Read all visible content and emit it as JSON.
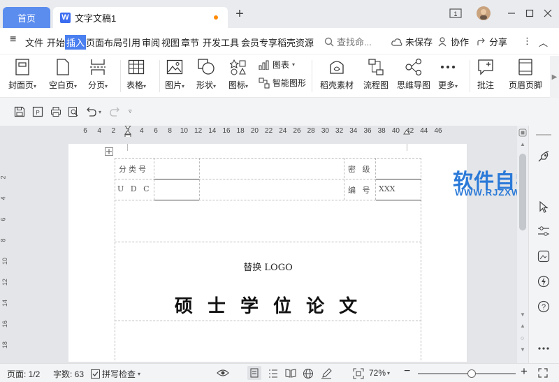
{
  "titlebar": {
    "home_tab": "首页",
    "doc_tab": "文字文稿1",
    "doc_icon_letter": "W",
    "new_tab": "+",
    "window_count": "1",
    "minimize": "—",
    "close": "✕"
  },
  "menubar": {
    "hamburger": "≡",
    "items": [
      "文件",
      "开始",
      "插入",
      "页面布局",
      "引用",
      "审阅",
      "视图",
      "章节",
      "开发工具",
      "会员专享",
      "稻壳资源"
    ],
    "active_item": "插入",
    "search_placeholder": "查找命...",
    "unsaved": "未保存",
    "collaborate": "协作",
    "share": "分享",
    "more": "⋮",
    "collapse": "︿"
  },
  "ribbon": {
    "cover": "封面页",
    "blank_page": "空白页",
    "page_break": "分页",
    "table": "表格",
    "picture": "图片",
    "shape": "形状",
    "icon": "图标",
    "chart": "图表",
    "smart_art": "智能图形",
    "docer_material": "稻壳素材",
    "flowchart": "流程图",
    "mindmap": "思维导图",
    "more": "更多",
    "comment": "批注",
    "header_footer": "页眉页脚"
  },
  "ruler": {
    "ticks": [
      "6",
      "4",
      "2",
      "2",
      "4",
      "6",
      "8",
      "10",
      "12",
      "14",
      "16",
      "18",
      "20",
      "22",
      "24",
      "26",
      "28",
      "30",
      "32",
      "34",
      "36",
      "38",
      "40",
      "42",
      "44",
      "46"
    ],
    "vticks": [
      "2",
      "4",
      "6",
      "8",
      "10",
      "12",
      "14",
      "16",
      "18"
    ]
  },
  "document": {
    "class_no_label": "分类号",
    "secret_label": "密 级",
    "udc_label": "U D C",
    "number_label": "编 号",
    "number_value": "XXX",
    "logo_text": "替换 LOGO",
    "thesis_title": "硕 士 学 位 论 文"
  },
  "watermark": {
    "main": "软件自学网",
    "sub": "WWW.RJZXW.COM"
  },
  "statusbar": {
    "page": "页面: 1/2",
    "word_count": "字数: 63",
    "spell_check": "拼写检查",
    "zoom": "72%",
    "zoom_level": 0.55
  }
}
